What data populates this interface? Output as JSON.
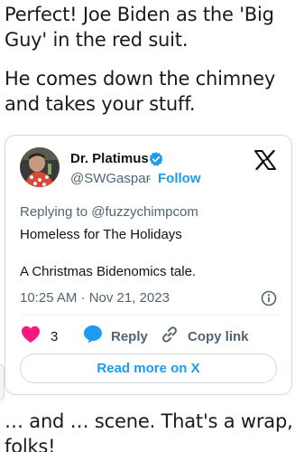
{
  "post": {
    "paragraph1": "Perfect! Joe Biden as the 'Big Guy' in the red suit.",
    "paragraph2": "He comes down the chimney and takes your stuff.",
    "paragraph3": "… and … scene. That's a wrap, folks!"
  },
  "tweet": {
    "author_name": "Dr. Platimus",
    "handle": "@SWGaspar",
    "separator": "·",
    "follow_label": "Follow",
    "reply_to": "Replying to @fuzzychimpcom",
    "line1": "Homeless for The Holidays",
    "line2": "A Christmas Bidenomics tale.",
    "timestamp": "10:25 AM · Nov 21, 2023",
    "likes_count": "3",
    "reply_label": "Reply",
    "copy_link_label": "Copy link",
    "read_more_label": "Read more on X"
  },
  "icons": {
    "verified": "verified-badge-icon",
    "platform_logo": "x-logo-icon",
    "info": "info-icon",
    "like": "heart-icon",
    "reply": "reply-bubble-icon",
    "copy_link": "link-icon"
  },
  "colors": {
    "accent": "#1d9bf0",
    "like": "#f91880",
    "text": "#0f1419",
    "muted": "#536471",
    "border": "#cfd9de"
  }
}
